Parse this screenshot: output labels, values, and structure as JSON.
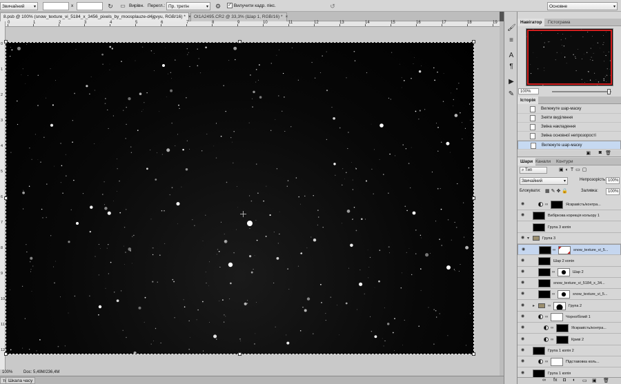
{
  "options_bar": {
    "mode_value": "Звичайний",
    "x_label": "х",
    "refine_label": "Вирівн.",
    "perspective_label": "Перегл.:",
    "perspective_value": "Пр. третін",
    "delete_cropped_label": "Вилучити кадр. пікс.",
    "delete_cropped_checked": true,
    "workspace_value": "Основне"
  },
  "tabs": [
    {
      "label": "8.psb @ 100% (snow_texture_vi_5184_x_3456_pixels_by_moosplauze-d4jgvyu, RGB/16) *",
      "close": "×"
    },
    {
      "label": "OI1A2495.CR2 @ 33,3% (Шар 1, RGB/16) *",
      "close": "×"
    }
  ],
  "rulers": {
    "h_labels": [
      "0",
      "1",
      "2",
      "3",
      "4",
      "5",
      "6",
      "7",
      "8",
      "9",
      "10",
      "11",
      "12",
      "13",
      "14",
      "15",
      "16",
      "17",
      "18",
      "19"
    ],
    "v_labels": [
      "0",
      "1",
      "2",
      "3",
      "4",
      "5",
      "6",
      "7",
      "8",
      "9",
      "10",
      "11",
      "12",
      "13"
    ]
  },
  "status": {
    "zoom": "100%",
    "doc_info": "Doc: 5,49M/236,4M"
  },
  "timeline": {
    "tab_left": "тке",
    "tab_label": "Шкала часу"
  },
  "navigator": {
    "tab_active": "Навігатор",
    "tab_other": "Гістограма",
    "zoom_value": "100%"
  },
  "history": {
    "title": "Історія",
    "items": [
      "Вилежуте шар-маску",
      "Зняти виділення",
      "Зміна накладення",
      "Зміна основної непрозорості",
      "Вилежуте шар-маску"
    ]
  },
  "layers": {
    "tabs": [
      "Шари",
      "Канали",
      "Контури"
    ],
    "filter_label": "Тип",
    "blend_mode": "Звичайний",
    "opacity_label": "Непрозорість:",
    "opacity_value": "100%",
    "lock_label": "Блокувати:",
    "fill_label": "Заливка:",
    "fill_value": "100%",
    "rows": [
      {
        "name": "Яскравість/контра..."
      },
      {
        "name": "Вибіркова корекція кольору 1"
      },
      {
        "name": "Група 3 копія"
      },
      {
        "name": "Група 3"
      },
      {
        "name": "snow_texture_vi_5..."
      },
      {
        "name": "Шар 2 копія"
      },
      {
        "name": "Шар 2"
      },
      {
        "name": "snow_texture_vi_5184_x_34..."
      },
      {
        "name": "snow_texture_vi_5..."
      },
      {
        "name": "Група 2"
      },
      {
        "name": "Чорно/білий 1"
      },
      {
        "name": "Яскравість/контра..."
      },
      {
        "name": "Криві 2"
      },
      {
        "name": "Група 1 копія 2"
      },
      {
        "name": "Підставовка коль..."
      },
      {
        "name": "Група 1 копія"
      }
    ]
  },
  "colors": {
    "selection": "#c5d6ef",
    "navigator_frame": "#d52020",
    "panel_bg": "#d6d6d6",
    "canvas_bg": "#000000"
  },
  "icons": [
    "rotate-icon",
    "gear-icon",
    "history-brush-icon",
    "adjust-icon",
    "text-icon",
    "paragraph-icon",
    "play-icon",
    "tool-preset-icon",
    "eye-icon",
    "link-icon",
    "folder-icon",
    "mask-icon",
    "trash-icon",
    "new-layer-icon"
  ]
}
